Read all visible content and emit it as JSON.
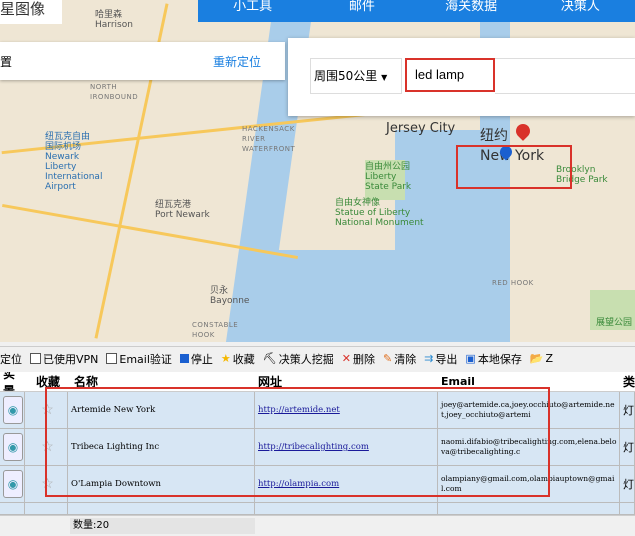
{
  "nav": {
    "brand": "星图像",
    "items": [
      "小工具",
      "邮件",
      "海关数据",
      "决策人"
    ]
  },
  "location": {
    "text": "置",
    "relocate": "重新定位"
  },
  "search": {
    "radius": "周围50公里",
    "keyword": "led lamp"
  },
  "map_labels": {
    "harrison": "哈里森\nHarrison",
    "newark_airport": "纽瓦克自由\n国际机场\nNewark\nLiberty\nInternational\nAirport",
    "hackensack": "HACKENSACK\nRIVER\nWATERFRONT",
    "jersey_city": "Jersey City",
    "new_york": "纽约\nNew York",
    "liberty_park": "自由州公园\nLiberty\nState Park",
    "statue": "自由女神像\nStatue of Liberty\nNational Monument",
    "brooklyn": "Brooklyn\nBridge Park",
    "port_newark": "纽瓦克港\nPort Newark",
    "bayonne": "贝永\nBayonne",
    "constable": "CONSTABLE\nHOOK",
    "red_hook": "RED HOOK",
    "prospect": "展望公园",
    "north_ironbound": "NORTH\nIRONBOUND"
  },
  "toolbar": {
    "locate": "定位",
    "vpn": "已使用VPN",
    "email_verify": "Email验证",
    "stop": "停止",
    "favorite": "收藏",
    "decision_maker": "决策人挖掘",
    "delete": "删除",
    "clear": "清除",
    "export": "导出",
    "local_save": "本地保存",
    "open": "Z"
  },
  "table": {
    "headers": [
      "实景",
      "收藏",
      "名称",
      "网址",
      "Email",
      "类"
    ],
    "rows": [
      {
        "name": "Artemide New York",
        "url": "http://artemide.net",
        "email": "joey@artemide.ca,joey.occhiuto@artemide.net,joey_occhiuto@artemi",
        "type": "灯"
      },
      {
        "name": "Tribeca Lighting Inc",
        "url": "http://tribecalighting.com",
        "email": "naomi.difabio@tribecalighting.com,elena.belova@tribecalighting.c",
        "type": "灯"
      },
      {
        "name": "O'Lampia Downtown",
        "url": "http://olampia.com",
        "email": "olampiany@gmail.com,olampiauptown@gmail.com",
        "type": "灯"
      }
    ]
  },
  "status": {
    "count": "数量:20"
  },
  "colors": {
    "accent": "#1a7fe0",
    "highlight": "#d9322a",
    "row_bg": "#d7e6f4"
  }
}
